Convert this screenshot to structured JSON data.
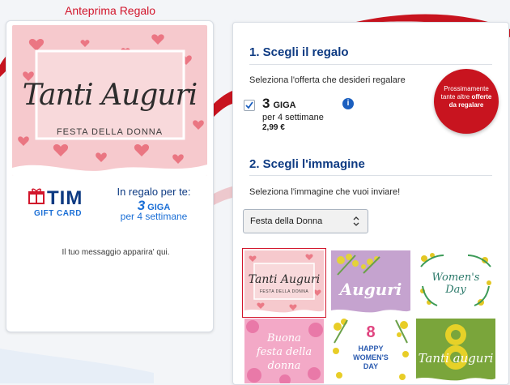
{
  "preview": {
    "title": "Anteprima Regalo",
    "card_script": "Tanti Auguri",
    "card_subtitle": "FESTA DELLA DONNA",
    "brand": "TIM",
    "gift_card_label": "GIFT CARD",
    "regalo_label": "In regalo per te:",
    "giga_value": "3",
    "giga_unit": "GIGA",
    "weeks_label": "per 4 settimane",
    "message_placeholder": "Il tuo messaggio apparira' qui."
  },
  "step1": {
    "title": "1. Scegli il regalo",
    "hint": "Seleziona l'offerta che desideri regalare",
    "offer": {
      "checked": true,
      "giga_value": "3",
      "giga_unit": "GIGA",
      "weeks": "per 4 settimane",
      "price": "2,99 €"
    },
    "info_icon": "info-icon",
    "badge": {
      "line1": "Prossimamente",
      "line2_prefix": "tante altre",
      "line2_bold": "offerte",
      "line3": "da regalare"
    }
  },
  "step2": {
    "title": "2. Scegli l'immagine",
    "hint": "Seleziona l'immagine che vuoi inviare!",
    "dropdown": {
      "selected": "Festa della Donna"
    },
    "thumbnails": [
      {
        "label": "Tanti Auguri",
        "sub": "FESTA DELLA DONNA",
        "selected": true
      },
      {
        "label": "Auguri"
      },
      {
        "label": "Women's Day"
      },
      {
        "label": "Buona festa della donna"
      },
      {
        "label": "8",
        "sub": "HAPPY WOMEN'S DAY"
      },
      {
        "label": "Tanti auguri"
      }
    ]
  },
  "colors": {
    "brand_red": "#d2152b",
    "brand_blue": "#0d3a82",
    "link_blue": "#1b6fd6",
    "card_pink": "#f6c9cd"
  }
}
